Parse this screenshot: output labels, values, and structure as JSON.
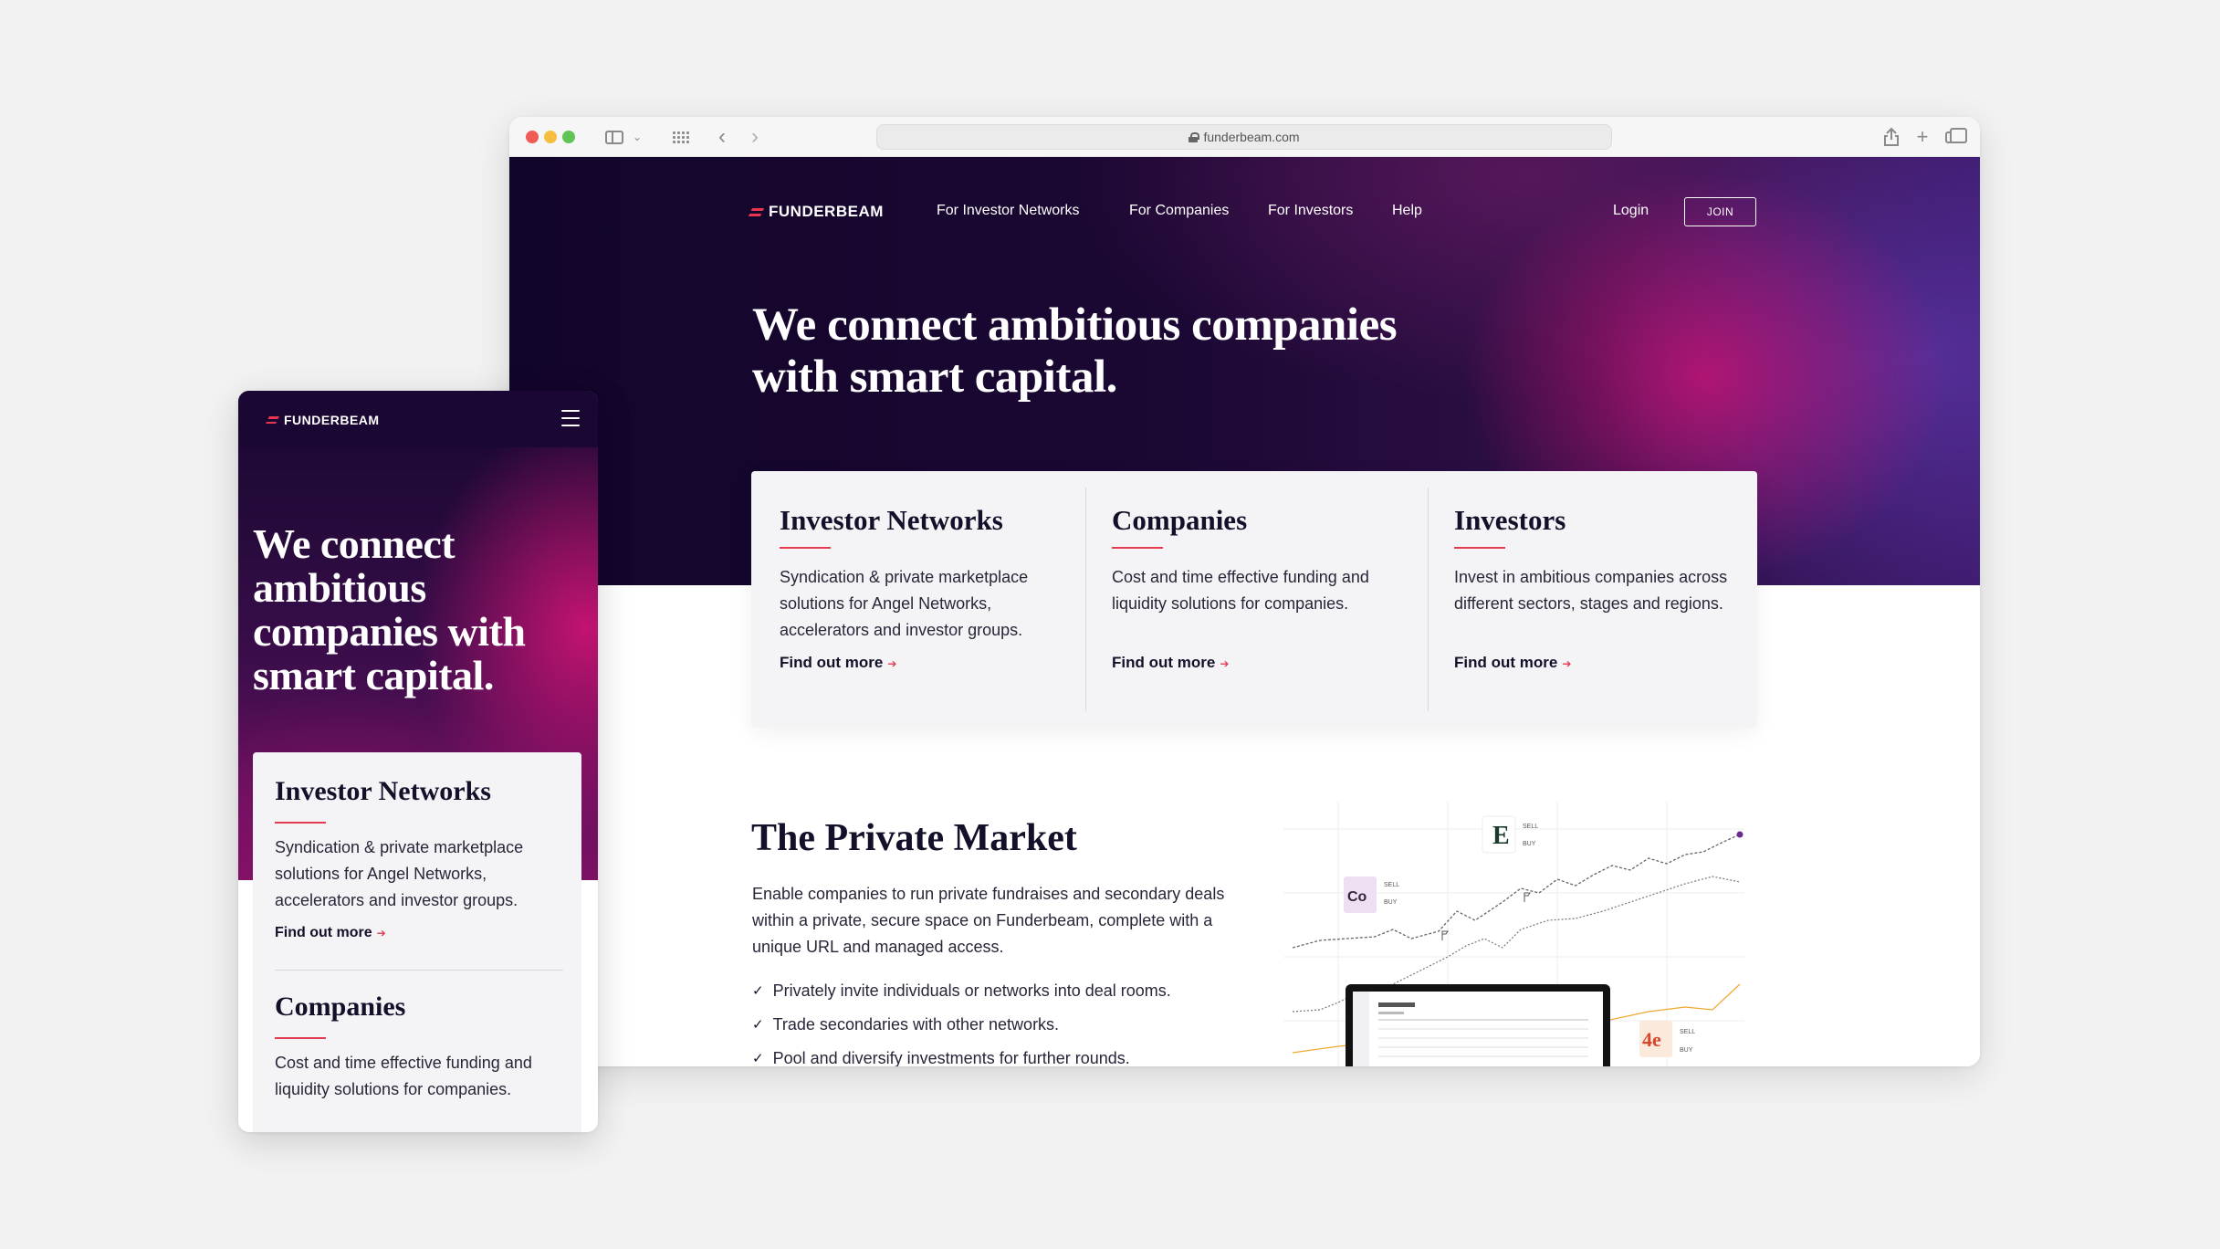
{
  "browser": {
    "url": "funderbeam.com"
  },
  "brand": {
    "name": "FUNDERBEAM",
    "accent_color": "#e33a4f",
    "hero_dark": "#12052a",
    "hero_magenta": "#e01278",
    "hero_purple": "#5832a0",
    "text_dark": "#15102a"
  },
  "desktop": {
    "nav": {
      "links": [
        "For Investor Networks",
        "For Companies",
        "For Investors",
        "Help"
      ],
      "login": "Login",
      "join": "JOIN"
    },
    "hero": {
      "headline_line1": "We connect ambitious companies",
      "headline_line2": "with smart capital."
    },
    "cards": [
      {
        "title": "Investor Networks",
        "text": "Syndication & private marketplace solutions for Angel Networks, accelerators and investor groups.",
        "link": "Find out more"
      },
      {
        "title": "Companies",
        "text": "Cost and time effective funding and liquidity solutions for companies.",
        "link": "Find out more"
      },
      {
        "title": "Investors",
        "text": "Invest in ambitious companies across different sectors, stages and regions.",
        "link": "Find out more"
      }
    ],
    "private_market": {
      "title": "The Private Market",
      "text": "Enable companies to run private fundraises and secondary deals within a private, secure space on Funderbeam, complete with a unique URL and managed access.",
      "bullets": [
        "Privately invite individuals or networks into deal rooms.",
        "Trade secondaries with other networks.",
        "Pool and diversify investments for further rounds."
      ],
      "graphic": {
        "tile_e": "E",
        "tile_co": "Co",
        "tile_4e": "4e",
        "sell": "SELL",
        "buy": "BUY"
      }
    }
  },
  "mobile": {
    "hero": {
      "headline_line1": "We connect",
      "headline_line2": "ambitious",
      "headline_line3": "companies with",
      "headline_line4": "smart capital."
    },
    "cards": [
      {
        "title": "Investor Networks",
        "text": "Syndication & private marketplace solutions for Angel Networks, accelerators and investor groups.",
        "link": "Find out more"
      },
      {
        "title": "Companies",
        "text": "Cost and time effective funding and liquidity solutions for companies."
      }
    ]
  },
  "icons": {
    "browser": [
      "sidebar-icon",
      "chevron-down-icon",
      "grid-icon",
      "back-icon",
      "forward-icon",
      "lock-icon",
      "share-icon",
      "new-tab-icon",
      "tabs-icon"
    ],
    "mobile": [
      "hamburger-menu-icon"
    ],
    "links": [
      "arrow-right-icon"
    ],
    "bullets": [
      "checkmark-icon"
    ]
  }
}
